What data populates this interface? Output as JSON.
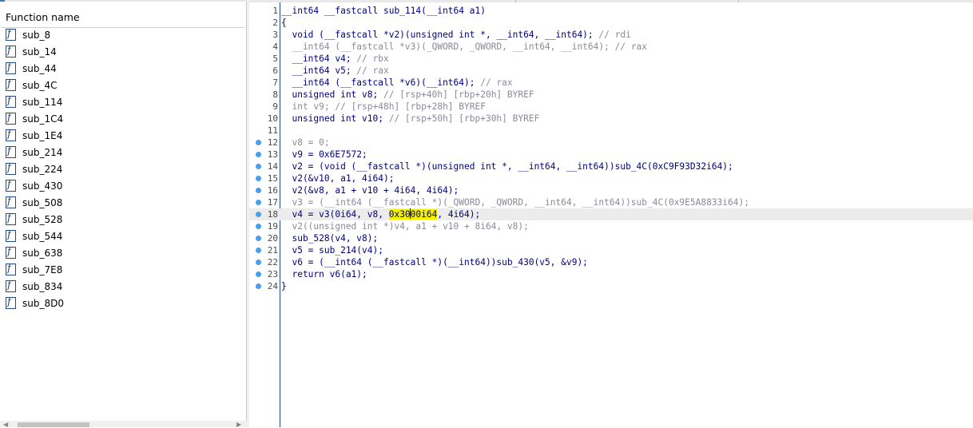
{
  "function_list": {
    "header": "Function name",
    "items": [
      "sub_8",
      "sub_14",
      "sub_44",
      "sub_4C",
      "sub_114",
      "sub_1C4",
      "sub_1E4",
      "sub_214",
      "sub_224",
      "sub_430",
      "sub_508",
      "sub_528",
      "sub_544",
      "sub_638",
      "sub_7E8",
      "sub_834",
      "sub_8D0"
    ],
    "icon_glyph": "f"
  },
  "pseudocode": {
    "current_line": 18,
    "lines": [
      {
        "n": "1",
        "bp": false,
        "segs": [
          [
            "__int64 __fastcall sub_114(__int64 a1)",
            "navy"
          ]
        ]
      },
      {
        "n": "2",
        "bp": false,
        "segs": [
          [
            "{",
            "navy"
          ]
        ]
      },
      {
        "n": "3",
        "bp": false,
        "segs": [
          [
            "  void (__fastcall *v2)(unsigned int *, __int64, __int64); ",
            "navy"
          ],
          [
            "// rdi",
            "grey"
          ]
        ]
      },
      {
        "n": "4",
        "bp": false,
        "segs": [
          [
            "  __int64 (__fastcall *v3)(_QWORD, _QWORD, __int64, __int64); ",
            "grey"
          ],
          [
            "// rax",
            "grey"
          ]
        ]
      },
      {
        "n": "5",
        "bp": false,
        "segs": [
          [
            "  __int64 v4; ",
            "navy"
          ],
          [
            "// rbx",
            "grey"
          ]
        ]
      },
      {
        "n": "6",
        "bp": false,
        "segs": [
          [
            "  __int64 v5; ",
            "navy"
          ],
          [
            "// rax",
            "grey"
          ]
        ]
      },
      {
        "n": "7",
        "bp": false,
        "segs": [
          [
            "  __int64 (__fastcall *v6)(__int64); ",
            "navy"
          ],
          [
            "// rax",
            "grey"
          ]
        ]
      },
      {
        "n": "8",
        "bp": false,
        "segs": [
          [
            "  unsigned int v8; ",
            "navy"
          ],
          [
            "// [rsp+40h] [rbp+20h] BYREF",
            "grey"
          ]
        ]
      },
      {
        "n": "9",
        "bp": false,
        "segs": [
          [
            "  int v9; ",
            "grey"
          ],
          [
            "// [rsp+48h] [rbp+28h] BYREF",
            "grey"
          ]
        ]
      },
      {
        "n": "10",
        "bp": false,
        "segs": [
          [
            "  unsigned int v10; ",
            "navy"
          ],
          [
            "// [rsp+50h] [rbp+30h] BYREF",
            "grey"
          ]
        ]
      },
      {
        "n": "11",
        "bp": false,
        "segs": [
          [
            "",
            "navy"
          ]
        ]
      },
      {
        "n": "12",
        "bp": true,
        "segs": [
          [
            "  v8 = 0;",
            "grey"
          ]
        ]
      },
      {
        "n": "13",
        "bp": true,
        "segs": [
          [
            "  v9 = 0x6E7572;",
            "navy"
          ]
        ]
      },
      {
        "n": "14",
        "bp": true,
        "segs": [
          [
            "  v2 = (void (__fastcall *)(unsigned int *, __int64, __int64))sub_4C(0xC9F93D32i64);",
            "navy"
          ]
        ]
      },
      {
        "n": "15",
        "bp": true,
        "segs": [
          [
            "  v2(&v10, a1, 4i64);",
            "navy"
          ]
        ]
      },
      {
        "n": "16",
        "bp": true,
        "segs": [
          [
            "  v2(&v8, a1 + v10 + 4i64, 4i64);",
            "navy"
          ]
        ]
      },
      {
        "n": "17",
        "bp": true,
        "segs": [
          [
            "  v3 = (__int64 (__fastcall *)(_QWORD, _QWORD, __int64, __int64))sub_4C(0x9E5A8833i64);",
            "grey"
          ]
        ]
      },
      {
        "n": "18",
        "bp": true,
        "segs": [
          [
            "  v4 = v3(0i64, v8, ",
            "navy"
          ],
          [
            "0x30",
            "hl"
          ],
          [
            "|",
            ""
          ],
          [
            "00i64",
            "hl"
          ],
          [
            ", 4i64);",
            "navy"
          ]
        ]
      },
      {
        "n": "19",
        "bp": true,
        "segs": [
          [
            "  v2((unsigned int *)v4, a1 + v10 + 8i64, v8);",
            "grey"
          ]
        ]
      },
      {
        "n": "20",
        "bp": true,
        "segs": [
          [
            "  sub_528(v4, v8);",
            "navy"
          ]
        ]
      },
      {
        "n": "21",
        "bp": true,
        "segs": [
          [
            "  v5 = sub_214(v4);",
            "navy"
          ]
        ]
      },
      {
        "n": "22",
        "bp": true,
        "segs": [
          [
            "  v6 = (__int64 (__fastcall *)(__int64))sub_430(v5, &v9);",
            "navy"
          ]
        ]
      },
      {
        "n": "23",
        "bp": true,
        "segs": [
          [
            "  return v6(a1);",
            "navy"
          ]
        ]
      },
      {
        "n": "24",
        "bp": true,
        "segs": [
          [
            "}",
            "navy"
          ]
        ]
      }
    ]
  },
  "colors": {
    "keyword_navy": "#000080",
    "comment_grey": "#8a8a9a",
    "breakpoint_blue": "#4a9fe8",
    "highlight_yellow": "#f5f200"
  }
}
